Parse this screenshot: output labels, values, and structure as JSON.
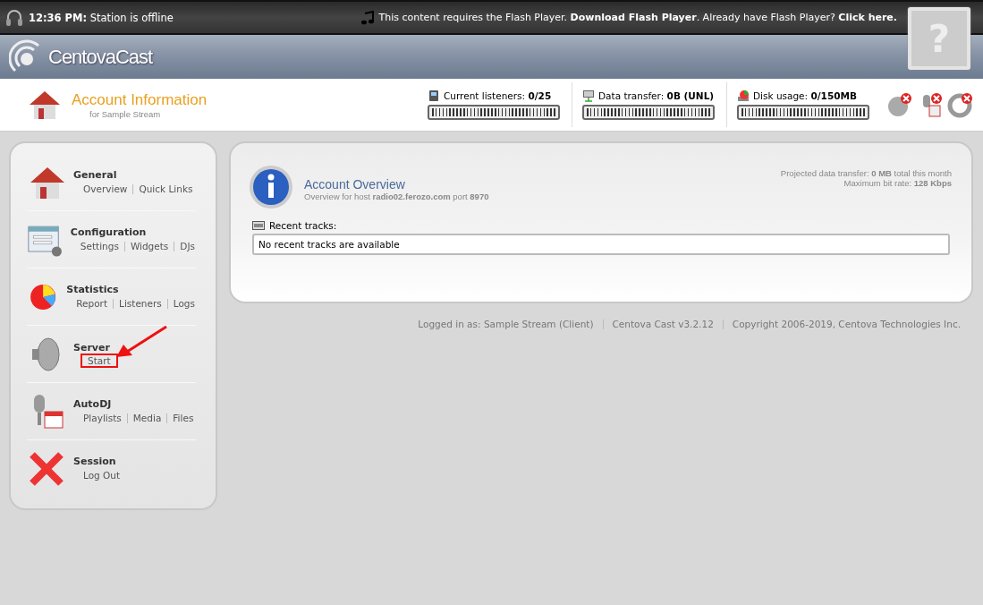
{
  "status_bar": {
    "status": "**12:36 PM:** Station is offline",
    "flash_notice": "This content requires the Flash Player. **Download Flash Player**. Already have Flash Player? **Click here.**",
    "help_glyph": "?"
  },
  "brand": {
    "name": "CentovaCast"
  },
  "account": {
    "title": "Account Information",
    "subtitle": "for Sample Stream"
  },
  "meters": [
    {
      "kind": "listeners",
      "label": "Current listeners: **0/25**",
      "level": 0
    },
    {
      "kind": "transfer",
      "label": "Data transfer: **0B (UNL)**",
      "level": 0
    },
    {
      "kind": "disk",
      "label": "Disk usage: **0/150MB**",
      "level": 0
    }
  ],
  "sidebar": {
    "sections": [
      {
        "kind": "general",
        "title": "General",
        "links": [
          {
            "label": "Overview",
            "highlighted": false
          },
          {
            "label": "Quick Links",
            "highlighted": false
          }
        ]
      },
      {
        "kind": "configuration",
        "title": "Configuration",
        "links": [
          {
            "label": "Settings",
            "highlighted": false
          },
          {
            "label": "Widgets",
            "highlighted": false
          },
          {
            "label": "DJs",
            "highlighted": false
          }
        ]
      },
      {
        "kind": "statistics",
        "title": "Statistics",
        "links": [
          {
            "label": "Report",
            "highlighted": false
          },
          {
            "label": "Listeners",
            "highlighted": false
          },
          {
            "label": "Logs",
            "highlighted": false
          }
        ]
      },
      {
        "kind": "server",
        "title": "Server",
        "links": [
          {
            "label": "Start",
            "highlighted": true
          }
        ]
      },
      {
        "kind": "autodj",
        "title": "AutoDJ",
        "links": [
          {
            "label": "Playlists",
            "highlighted": false
          },
          {
            "label": "Media",
            "highlighted": false
          },
          {
            "label": "Files",
            "highlighted": false
          }
        ]
      },
      {
        "kind": "session",
        "title": "Session",
        "links": [
          {
            "label": "Log Out",
            "highlighted": false
          }
        ]
      }
    ]
  },
  "overview": {
    "title": "Account Overview",
    "subtitle": "Overview for host **radio02.ferozo.com** port **8970**",
    "projected": "Projected data transfer:  **0 MB** total this month",
    "bitrate": "Maximum bit rate: **128 Kbps**",
    "recent_label": "Recent tracks:",
    "recent_empty": "No recent tracks are available"
  },
  "footer": [
    "Logged in as: Sample Stream (Client)",
    "Centova Cast v3.2.12",
    "Copyright 2006-2019, Centova Technologies Inc."
  ]
}
